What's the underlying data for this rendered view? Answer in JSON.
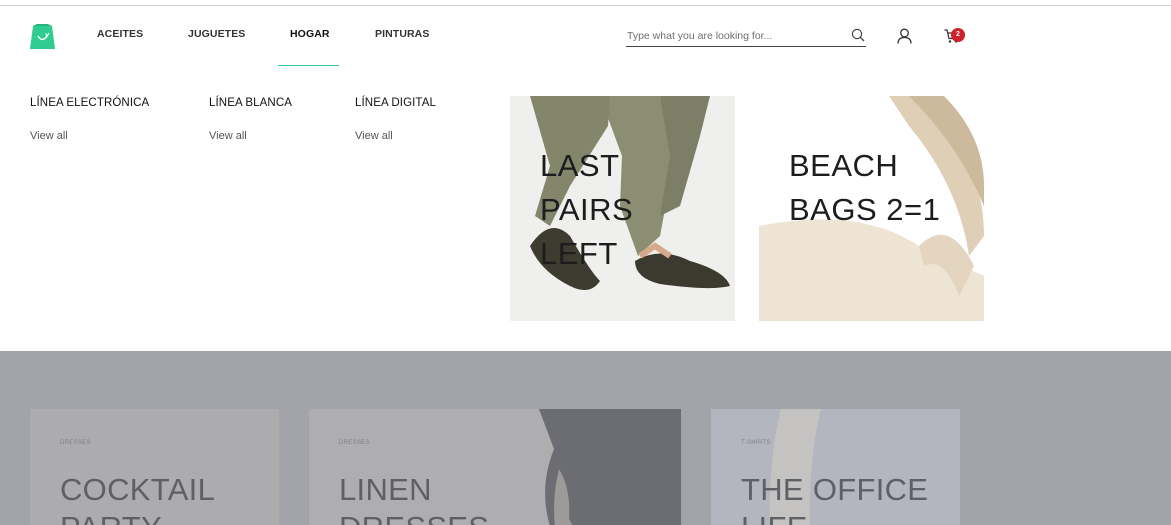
{
  "header": {
    "nav": [
      "ACEITES",
      "JUGUETES",
      "HOGAR",
      "PINTURAS"
    ],
    "active_nav": "HOGAR",
    "search": {
      "placeholder": "Type what you are looking for..."
    },
    "cart_count": "2",
    "colors": {
      "accent": "#2ecc8f",
      "badge": "#d0202a",
      "logo": "#2ecc8f"
    }
  },
  "mega_menu": {
    "categories": [
      {
        "title": "LÍNEA ELECTRÓNICA",
        "link": "View all"
      },
      {
        "title": "LÍNEA BLANCA",
        "link": "View all"
      },
      {
        "title": "LÍNEA DIGITAL",
        "link": "View all"
      }
    ],
    "promos": [
      {
        "lines": [
          "LAST",
          "PAIRS",
          "LEFT"
        ]
      },
      {
        "lines": [
          "BEACH",
          "BAGS 2=1"
        ]
      }
    ]
  },
  "background_cards": [
    {
      "subtitle": "DRESSES",
      "title_lines": [
        "COCKTAIL",
        "PARTY"
      ]
    },
    {
      "subtitle": "DRESSES",
      "title_lines": [
        "LINEN",
        "DRESSES"
      ]
    },
    {
      "subtitle": "T-SHIRTS",
      "title_lines": [
        "THE OFFICE",
        "LIFE"
      ]
    }
  ]
}
